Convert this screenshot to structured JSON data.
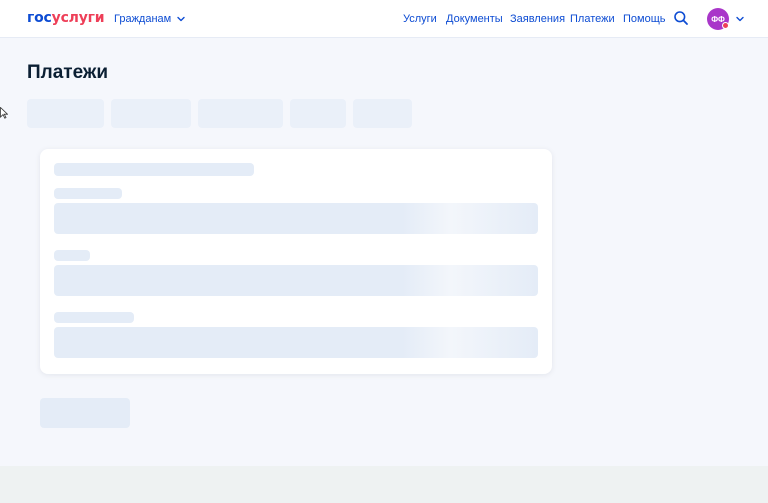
{
  "header": {
    "logo_part1": "гос",
    "logo_part2": "услуги",
    "audience_label": "Гражданам",
    "nav": [
      "Услуги",
      "Документы",
      "Заявления",
      "Платежи",
      "Помощь"
    ],
    "user_initials": "ФФ"
  },
  "main": {
    "title": "Платежи"
  },
  "colors": {
    "accent": "#0d4cd3",
    "logo_red": "#ee3f58",
    "avatar": "#a936c9",
    "skeleton": "#e4ecf7",
    "background": "#f5f7fc"
  },
  "icons": [
    "chevron-down-icon",
    "search-icon",
    "notification-dot",
    "cursor-icon"
  ]
}
